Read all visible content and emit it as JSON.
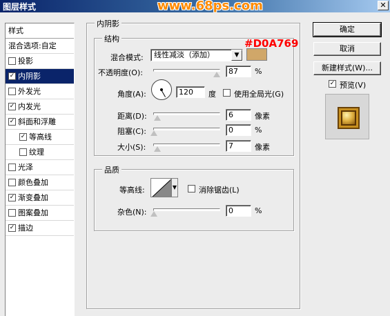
{
  "window": {
    "title": "图层样式",
    "watermark": "www.68ps.com"
  },
  "sidebar": {
    "header": "样式",
    "blend_options": "混合选项:自定",
    "items": [
      {
        "label": "投影",
        "checked": false,
        "check_glyph": ""
      },
      {
        "label": "内阴影",
        "checked": true,
        "check_glyph": "✓"
      },
      {
        "label": "外发光",
        "checked": false,
        "check_glyph": ""
      },
      {
        "label": "内发光",
        "checked": true,
        "check_glyph": "✓"
      },
      {
        "label": "斜面和浮雕",
        "checked": true,
        "check_glyph": "✓"
      },
      {
        "label": "等高线",
        "checked": true,
        "check_glyph": "✓"
      },
      {
        "label": "纹理",
        "checked": false,
        "check_glyph": ""
      },
      {
        "label": "光泽",
        "checked": false,
        "check_glyph": ""
      },
      {
        "label": "颜色叠加",
        "checked": false,
        "check_glyph": ""
      },
      {
        "label": "渐变叠加",
        "checked": true,
        "check_glyph": "✓"
      },
      {
        "label": "图案叠加",
        "checked": false,
        "check_glyph": ""
      },
      {
        "label": "描边",
        "checked": true,
        "check_glyph": "✓"
      }
    ]
  },
  "inner_shadow": {
    "section_title": "内阴影",
    "structure": {
      "title": "结构",
      "blend_mode_label": "混合模式:",
      "blend_mode_value": "线性减淡（添加）",
      "color_hex": "#D0A769",
      "color_hex_label": "#D0A769",
      "opacity_label": "不透明度(O):",
      "opacity_value": "87",
      "opacity_unit": "%",
      "angle_label": "角度(A):",
      "angle_value": "120",
      "angle_unit": "度",
      "global_light_label": "使用全局光(G)",
      "global_light_checked": false,
      "distance_label": "距离(D):",
      "distance_value": "6",
      "distance_unit": "像素",
      "choke_label": "阻塞(C):",
      "choke_value": "0",
      "choke_unit": "%",
      "size_label": "大小(S):",
      "size_value": "7",
      "size_unit": "像素"
    },
    "quality": {
      "title": "品质",
      "contour_label": "等高线:",
      "anti_alias_label": "消除锯齿(L)",
      "anti_alias_checked": false,
      "noise_label": "杂色(N):",
      "noise_value": "0",
      "noise_unit": "%"
    }
  },
  "buttons": {
    "ok": "确定",
    "cancel": "取消",
    "new_style": "新建样式(W)...",
    "preview_label": "预览(V)",
    "preview_checked": true
  },
  "icons": {
    "close": "close-icon",
    "dropdown": "chevron-down-icon"
  }
}
